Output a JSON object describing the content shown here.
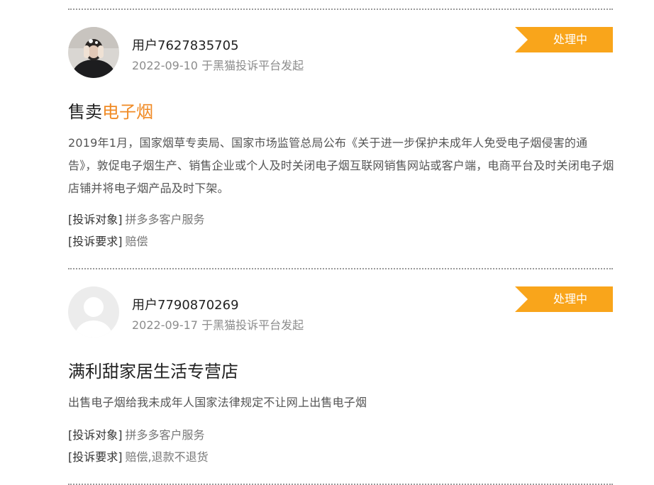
{
  "complaints": [
    {
      "username": "用户7627835705",
      "meta": "2022-09-10 于黑猫投诉平台发起",
      "status": "处理中",
      "title_prefix": "售卖",
      "title_highlight": "电子烟",
      "body": "2019年1月，国家烟草专卖局、国家市场监管总局公布《关于进一步保护未成年人免受电子烟侵害的通告》，敦促电子烟生产、销售企业或个人及时关闭电子烟互联网销售网站或客户端，电商平台及时关闭电子烟店铺并将电子烟产品及时下架。",
      "target_label": "[投诉对象]",
      "target_value": "拼多多客户服务",
      "demand_label": "[投诉要求]",
      "demand_value": "赔偿",
      "avatar_icon": "user-photo-avatar"
    },
    {
      "username": "用户7790870269",
      "meta": "2022-09-17 于黑猫投诉平台发起",
      "status": "处理中",
      "title_prefix": "满利甜家居生活专营店",
      "title_highlight": "",
      "body": "出售电子烟给我未成年人国家法律规定不让网上出售电子烟",
      "target_label": "[投诉对象]",
      "target_value": "拼多多客户服务",
      "demand_label": "[投诉要求]",
      "demand_value": "赔偿,退款不退货",
      "avatar_icon": "default-user-avatar"
    }
  ],
  "colors": {
    "status_bg": "#f9a51b",
    "highlight": "#f08a24",
    "divider": "#9a9a9a"
  }
}
